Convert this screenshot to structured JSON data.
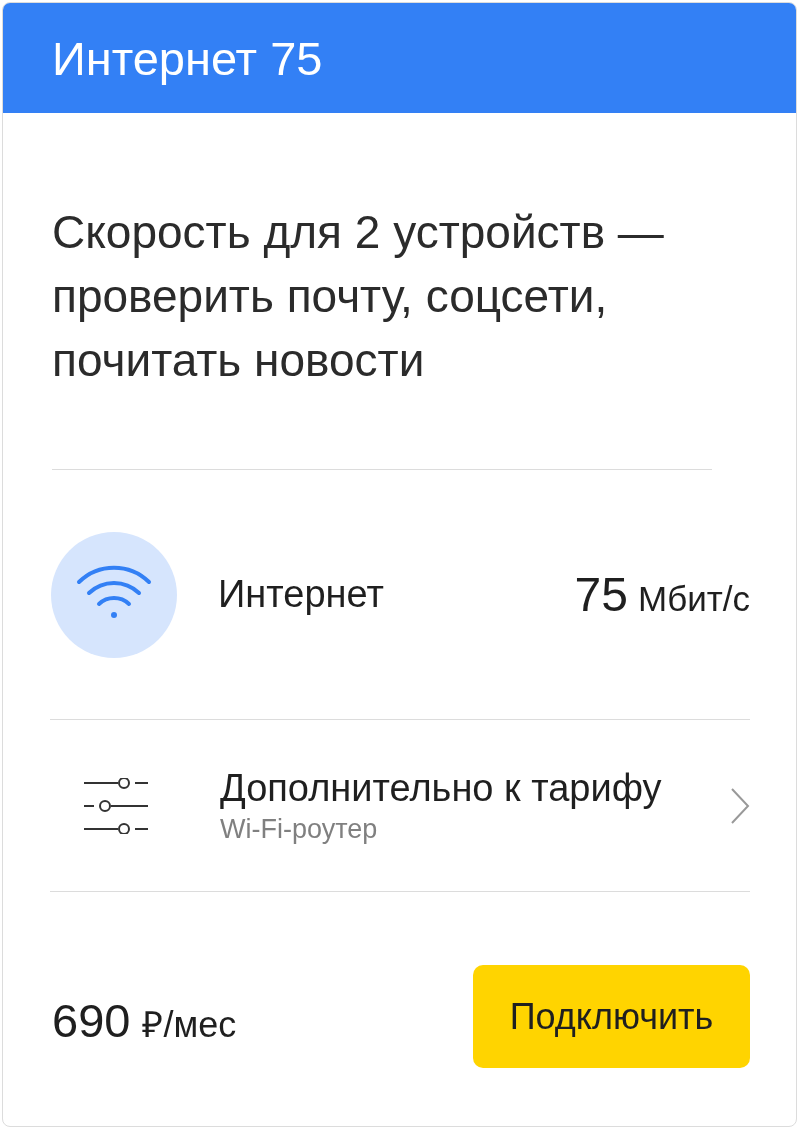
{
  "card": {
    "title": "Интернет 75",
    "description": "Скорость для 2 устройств — проверить почту, соцсети, почитать новости",
    "features": [
      {
        "kind": "speed",
        "label": "Интернет",
        "value": "75",
        "unit": "Мбит/с"
      },
      {
        "kind": "addon",
        "label": "Дополнительно к тарифу",
        "sublabel": "Wi-Fi-роутер"
      }
    ],
    "price": {
      "amount": "690",
      "unit": "₽/мес"
    },
    "button": "Подключить"
  }
}
